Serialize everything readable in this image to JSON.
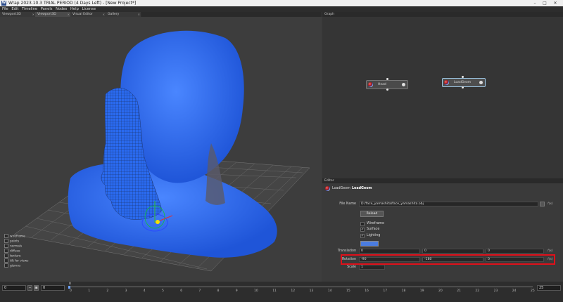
{
  "window": {
    "title": "Wrap 2023.10.3  TRIAL PERIOD (4 Days Left) - [New Project*]",
    "app_icon": "W"
  },
  "menu": [
    "File",
    "Edit",
    "Timeline",
    "Panels",
    "Nodes",
    "Help",
    "License"
  ],
  "viewport_tabs": [
    {
      "label": "Viewport3D",
      "active": false
    },
    {
      "label": "Viewport3D",
      "active": true
    },
    {
      "label": "Visual Editor",
      "active": false
    },
    {
      "label": "Gallery",
      "active": false
    }
  ],
  "viewport": {
    "toggles": [
      "wireframe",
      "points",
      "normals",
      "diffuse",
      "texture",
      "tilt for views",
      "gizmos"
    ],
    "mesh_color": "#2f6ff2"
  },
  "graph": {
    "title": "Graph",
    "nodes": [
      {
        "label": "Head",
        "selected": false
      },
      {
        "label": "LoadGeom",
        "selected": true
      }
    ]
  },
  "editor": {
    "title": "Editor",
    "node_type": "LoadGeom",
    "node_name": "LoadGeom",
    "file_name_label": "File Name",
    "file_name_value": "D:/face_yamashita/face_yamashita.obj",
    "reload_label": "Reload",
    "wireframe_label": "Wireframe",
    "surface_label": "Surface",
    "lighting_label": "Lighting",
    "color": "#4a7ce0",
    "translation_label": "Translation",
    "translation": [
      "0",
      "0",
      "0"
    ],
    "rotation_label": "Rotation",
    "rotation": [
      "-90",
      "-180",
      "0"
    ],
    "scale_label": "Scale",
    "scale": "1",
    "fx": "f(x)",
    "highlight_color": "#e0101a"
  },
  "timeline": {
    "start": "0",
    "end": "0",
    "current": "0",
    "max": "25",
    "ticks": [
      "0",
      "1",
      "2",
      "3",
      "4",
      "5",
      "6",
      "7",
      "8",
      "9",
      "10",
      "11",
      "12",
      "13",
      "14",
      "15",
      "16",
      "17",
      "18",
      "19",
      "20",
      "21",
      "22",
      "23",
      "24",
      "25"
    ]
  }
}
